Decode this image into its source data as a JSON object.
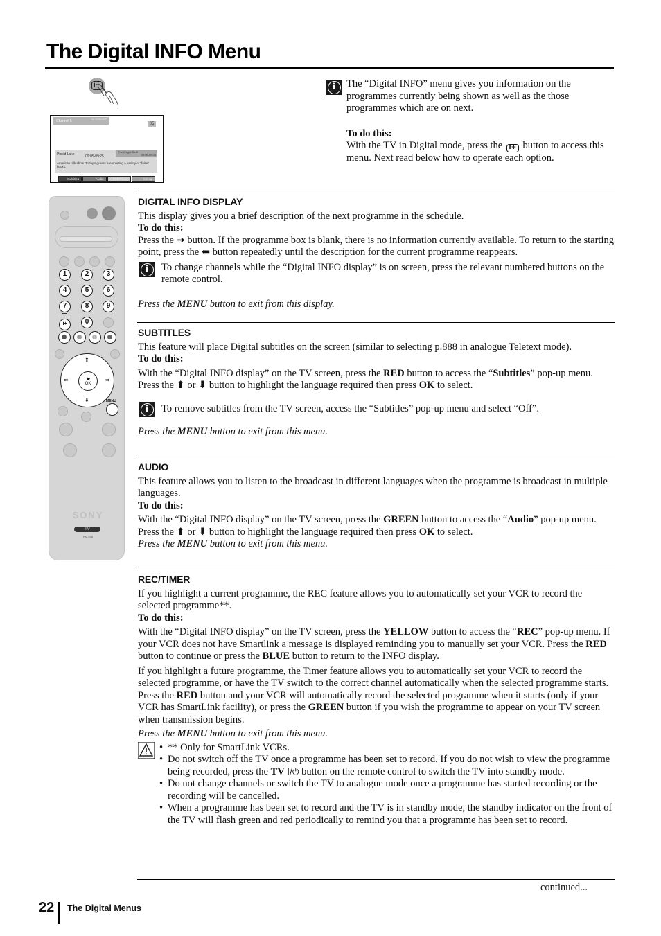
{
  "page": {
    "title": "The Digital INFO Menu",
    "page_number": "22",
    "footer_label": "The Digital Menus",
    "continued": "continued..."
  },
  "illustration": {
    "button_glyph": "i+",
    "tv_screen": {
      "channel": "Channel 5",
      "channel_time": "Tue 16 Mar 09:07",
      "number": "05",
      "current_programme": "Pickid Lake",
      "current_time": "09:05-09:25",
      "next_programme": "The Wright Stuff",
      "next_time": "09:05-09:35",
      "description": "American talk show. Today's guests are sporting a variety of \"false\" books.",
      "tabs": [
        {
          "label": "Subtitles",
          "color": "#444444"
        },
        {
          "label": "Audio",
          "color": "#7a7a7a"
        },
        {
          "label": "REC/Timer",
          "color": "#c8c8c8"
        },
        {
          "label": "Set-up",
          "color": "#a0a0a0"
        }
      ]
    }
  },
  "intro": {
    "icon": "info-icon",
    "text": "The “Digital INFO” menu gives you information on the programmes currently being shown as well as the those programmes which are on next.",
    "todo_label": "To do this:",
    "todo_before": "With the TV in Digital mode, press the",
    "todo_button": "i+",
    "todo_after": "button to access this menu. Next read below how to operate each option."
  },
  "remote": {
    "number_buttons": [
      "1",
      "2",
      "3",
      "4",
      "5",
      "6",
      "7",
      "8",
      "9",
      "0"
    ],
    "info_button": "i+",
    "ok_label": "OK",
    "menu_label": "MENU",
    "brand": "SONY",
    "tv_label": "TV",
    "model": "RM-948"
  },
  "sections": {
    "display": {
      "heading": "DIGITAL INFO DISPLAY",
      "intro": "This display gives you a brief description of the next programme in the schedule.",
      "todo_label": "To do this:",
      "body_1": "Press the",
      "right_arrow": "➔",
      "body_2": "button. If the programme box is blank, there is no information currently available. To return to the starting point, press the",
      "left_arrow": "⬅",
      "body_3": "button repeatedly until the description for the current programme reappears.",
      "note": "To change channels while the “Digital INFO display” is on screen, press the relevant numbered buttons on the remote control.",
      "exit_1": "Press the",
      "exit_key": "MENU",
      "exit_2": "button to exit from this display."
    },
    "subtitles": {
      "heading": "SUBTITLES",
      "intro": "This feature will place Digital subtitles on the screen (similar to selecting p.888 in analogue Teletext mode).",
      "todo_label": "To do this:",
      "b1": "With the “Digital INFO display” on the TV screen, press the",
      "k1": "RED",
      "b2": "button to access the “",
      "k2": "Subtitles",
      "b3": "” pop-up menu. Press the",
      "up": "⬆",
      "or": "or",
      "down": "⬇",
      "b4": "button to highlight the language required then press",
      "k3": "OK",
      "b5": "to select.",
      "note": "To remove subtitles from the TV screen, access the “Subtitles” pop-up menu and select “Off”.",
      "exit_1": "Press the",
      "exit_key": "MENU",
      "exit_2": "button to exit from this menu."
    },
    "audio": {
      "heading": "AUDIO",
      "intro": "This feature allows you to listen to the broadcast in different languages when the programme is broadcast in multiple languages.",
      "todo_label": "To do this:",
      "b1": "With the “Digital INFO display” on the TV screen, press the",
      "k1": "GREEN",
      "b2": "button to access the “",
      "k2": "Audio",
      "b3": "” pop-up menu. Press the",
      "up": "⬆",
      "or": "or",
      "down": "⬇",
      "b4": "button to highlight the language required then press",
      "k3": "OK",
      "b5": "to select.",
      "exit_1": "Press the",
      "exit_key": "MENU",
      "exit_2": "button to exit from this menu."
    },
    "rec": {
      "heading": "REC/TIMER",
      "intro": "If you highlight a current programme, the REC feature allows you to automatically set your VCR to record the selected programme**.",
      "todo_label": "To do this:",
      "p1_a": "With the “Digital INFO display” on the TV screen, press the",
      "p1_k1": "YELLOW",
      "p1_b": "button to access the “",
      "p1_k2": "REC",
      "p1_c": "” pop-up menu. If your VCR does not have Smartlink a message is displayed reminding you to manually set your VCR. Press the",
      "p1_k3": "RED",
      "p1_d": "button to continue or press the",
      "p1_k4": "BLUE",
      "p1_e": "button to return to the INFO display.",
      "p2": "If you highlight a future programme, the Timer feature allows you to automatically set your VCR to record the selected programme, or have the TV switch to the correct channel automatically when the selected programme starts.",
      "p3_a": "Press the",
      "p3_k1": "RED",
      "p3_b": "button and your VCR will automatically record the selected programme when it starts (only if your VCR has SmartLink facility), or press the",
      "p3_k2": "GREEN",
      "p3_c": "button if you wish the programme to appear on your TV screen when transmission begins.",
      "exit_1": "Press the",
      "exit_key": "MENU",
      "exit_2": "button to exit from this menu.",
      "warnings": {
        "w1": "** Only for SmartLink VCRs.",
        "w2_a": "Do not switch off the TV once a programme has been set to record. If you do not wish to view the programme being recorded, press the",
        "w2_k": "TV",
        "w2_sym": "I/⏻",
        "w2_b": "button on the remote control to switch the TV into standby mode.",
        "w3": "Do not change channels or switch the TV to analogue mode once a programme has started recording or the recording will be cancelled.",
        "w4": "When a programme has been set to record and the TV is in standby mode, the standby indicator on the front of the TV will flash green and red periodically to remind you that a programme has been set to record."
      }
    }
  }
}
